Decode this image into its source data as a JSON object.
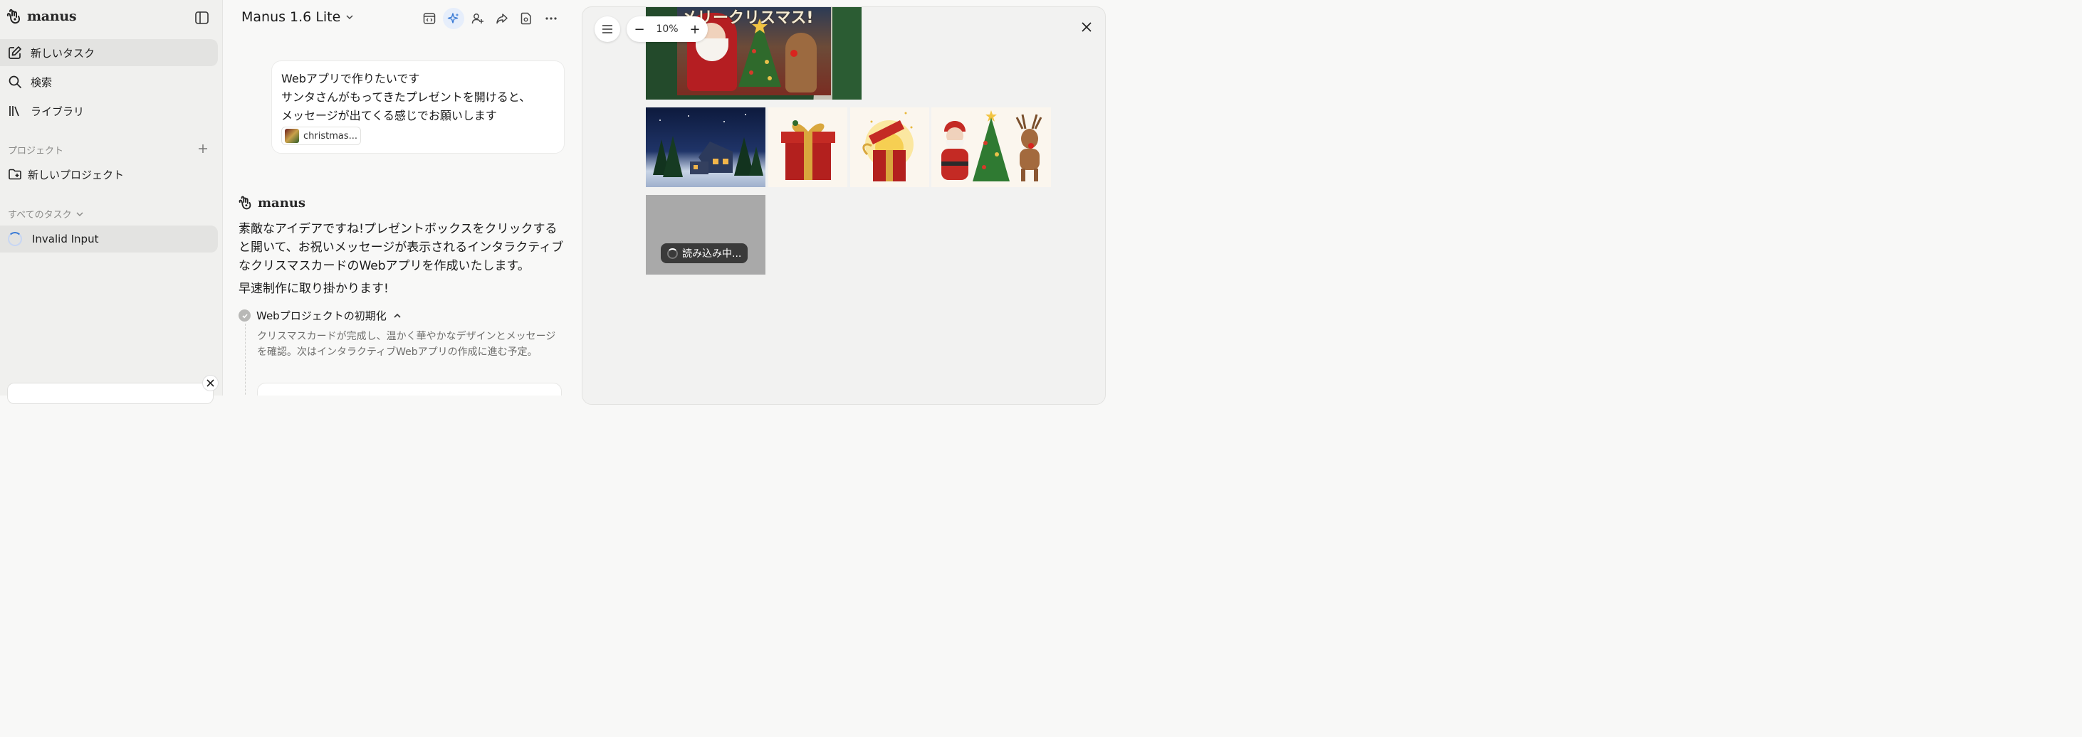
{
  "sidebar": {
    "brand": "manus",
    "nav": [
      {
        "label": "新しいタスク"
      },
      {
        "label": "検索"
      },
      {
        "label": "ライブラリ"
      }
    ],
    "projects_label": "プロジェクト",
    "new_project": "新しいプロジェクト",
    "all_tasks_label": "すべてのタスク",
    "tasks": [
      {
        "label": "Invalid Input"
      }
    ]
  },
  "chat": {
    "model": "Manus 1.6 Lite",
    "user_message": {
      "line1": "Webアプリで作りたいです",
      "line2": "サンタさんがもってきたプレゼントを開けると、",
      "line3": "メッセージが出てくる感じでお願いします",
      "attachment": "christmas..."
    },
    "agent_name": "manus",
    "agent_reply": "素敵なアイデアですね!プレゼントボックスをクリックすると開いて、お祝いメッセージが表示されるインタラクティブなクリスマスカードのWebアプリを作成いたします。",
    "agent_reply2": "早速制作に取り掛かります!",
    "step": {
      "title": "Webプロジェクトの初期化",
      "description": "クリスマスカードが完成し、温かく華やかなデザインとメッセージを確認。次はインタラクティブWebアプリの作成に進む予定。"
    }
  },
  "viewer": {
    "zoom": "10%",
    "zoom_minus": "−",
    "zoom_plus": "+",
    "banner_text": "メリークリスマス!",
    "loading": "読み込み中..."
  },
  "colors": {
    "accent": "#3a7bd5",
    "sidebar_bg": "#f0f0ee",
    "active_item": "#e3e3e1"
  }
}
